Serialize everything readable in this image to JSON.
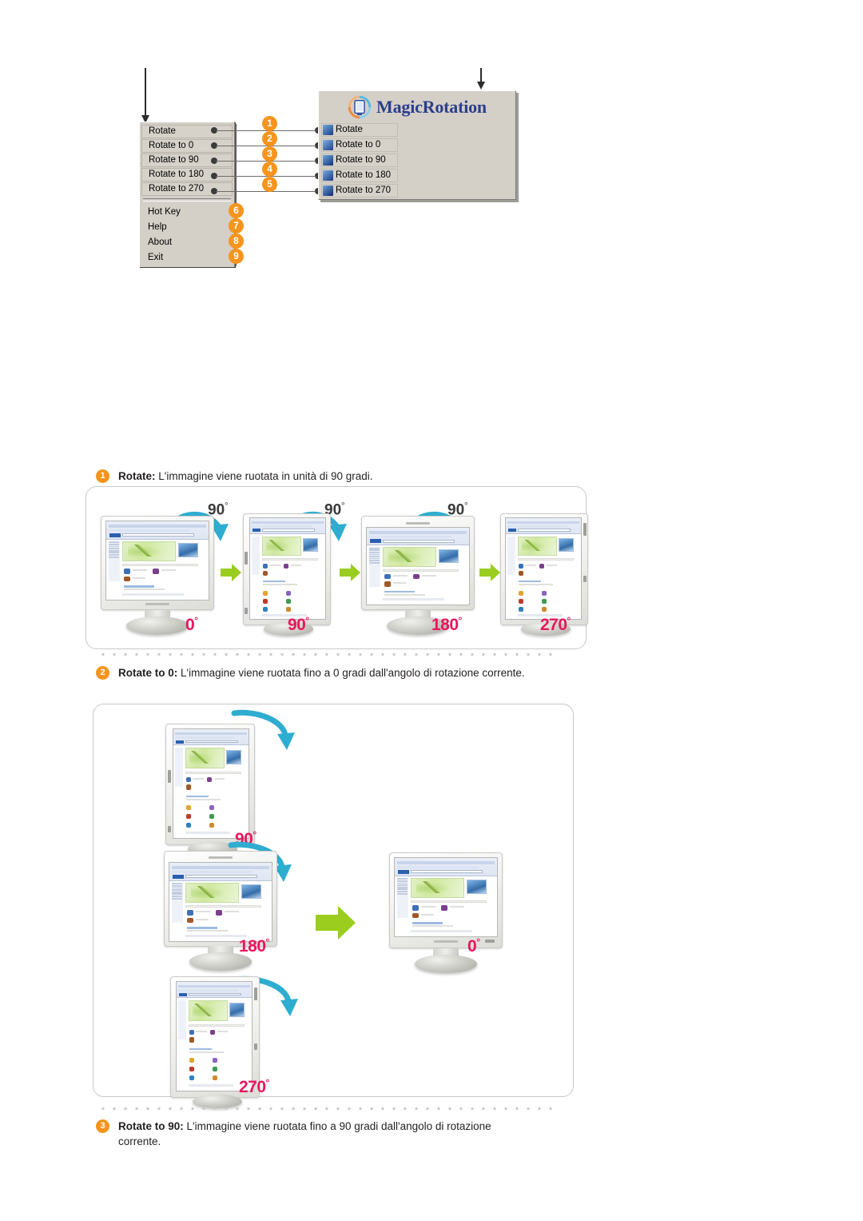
{
  "diagram": {
    "context_menu": {
      "name": "MagicRotation tray context menu",
      "boxed_items": [
        "Rotate",
        "Rotate to 0",
        "Rotate to 90",
        "Rotate to 180",
        "Rotate to 270"
      ],
      "plain_items": [
        "Hot Key",
        "Help",
        "About",
        "Exit"
      ]
    },
    "magic_rotation_panel": {
      "title": "MagicRotation",
      "items": [
        {
          "label": "Rotate",
          "icon": "rotate-icon"
        },
        {
          "label": "Rotate to 0",
          "icon": "rotate-to-0-icon"
        },
        {
          "label": "Rotate to 90",
          "icon": "rotate-to-90-icon"
        },
        {
          "label": "Rotate to 180",
          "icon": "rotate-to-180-icon"
        },
        {
          "label": "Rotate to 270",
          "icon": "rotate-to-270-icon"
        }
      ]
    },
    "callout_numbers": [
      "1",
      "2",
      "3",
      "4",
      "5",
      "6",
      "7",
      "8",
      "9"
    ]
  },
  "sections": [
    {
      "number": "1",
      "term": "Rotate",
      "separator": ":",
      "text": " L'immagine viene ruotata in unità di 90 gradi."
    },
    {
      "number": "2",
      "term": "Rotate to 0",
      "separator": ":",
      "text": " L'immagine viene ruotata fino a 0 gradi dall'angolo di rotazione corrente."
    },
    {
      "number": "3",
      "term": "Rotate to 90",
      "separator": ":",
      "text": " L'immagine viene ruotata fino a 90 gradi dall'angolo di rotazione corrente."
    }
  ],
  "figure1": {
    "top_labels": [
      "90",
      "90",
      "90"
    ],
    "state_labels": [
      "0",
      "90",
      "180",
      "270"
    ],
    "degree_mark": "°"
  },
  "figure2": {
    "step_labels": [
      "90",
      "180",
      "270",
      "0"
    ],
    "degree_mark": "°"
  },
  "colors": {
    "badge_orange": "#f6941d",
    "degree_pink": "#e8175d",
    "arrow_cyan": "#2eadd0",
    "arrow_green": "#9acd1e",
    "logo_blue": "#2b3e8c",
    "panel_gray": "#d4d0c8"
  }
}
